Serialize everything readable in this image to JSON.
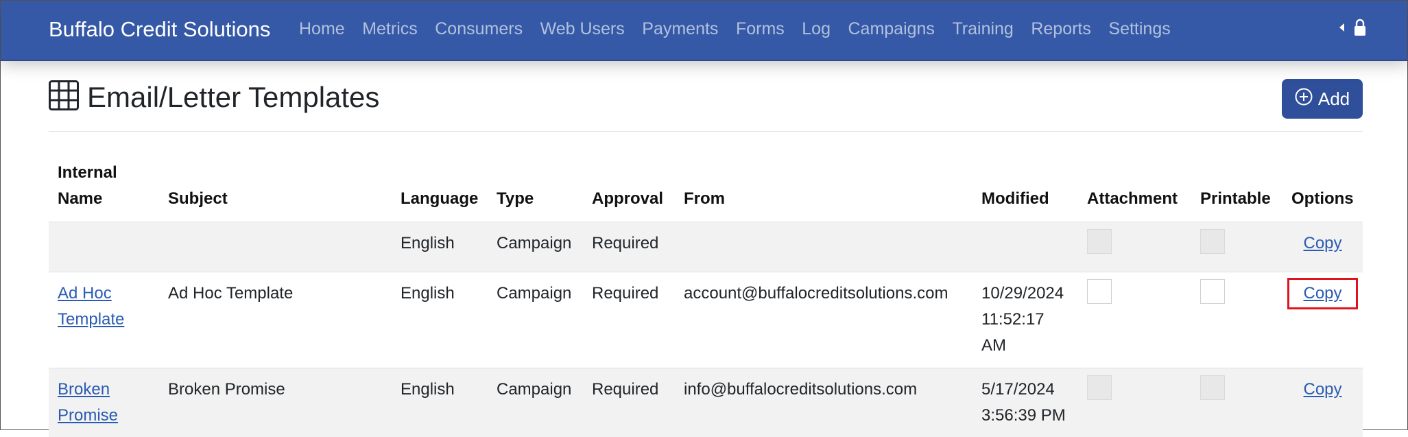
{
  "navbar": {
    "brand": "Buffalo Credit Solutions",
    "links": [
      "Home",
      "Metrics",
      "Consumers",
      "Web Users",
      "Payments",
      "Forms",
      "Log",
      "Campaigns",
      "Training",
      "Reports",
      "Settings"
    ],
    "right_icons": [
      "caret-left-icon",
      "lock-icon"
    ]
  },
  "header": {
    "icon": "grid-icon",
    "title": "Email/Letter Templates",
    "add_label": "Add",
    "add_icon": "plus-circle-icon"
  },
  "table": {
    "columns": {
      "internal_name_1": "Internal",
      "internal_name_2": "Name",
      "subject": "Subject",
      "language": "Language",
      "type": "Type",
      "approval": "Approval",
      "from": "From",
      "modified": "Modified",
      "attachment": "Attachment",
      "printable": "Printable",
      "options": "Options"
    },
    "rows": [
      {
        "name_1": "",
        "name_2": "",
        "subject": "",
        "language": "English",
        "type": "Campaign",
        "approval": "Required",
        "from": "",
        "modified_1": "",
        "modified_2": "",
        "modified_3": "",
        "attachment": false,
        "printable": false,
        "option": "Copy"
      },
      {
        "name_1": "Ad Hoc",
        "name_2": "Template",
        "subject": "Ad Hoc Template",
        "language": "English",
        "type": "Campaign",
        "approval": "Required",
        "from": "account@buffalocreditsolutions.com",
        "modified_1": "10/29/2024",
        "modified_2": "11:52:17",
        "modified_3": "AM",
        "attachment": false,
        "printable": false,
        "option": "Copy"
      },
      {
        "name_1": "Broken",
        "name_2": "Promise",
        "subject": "Broken Promise",
        "language": "English",
        "type": "Campaign",
        "approval": "Required",
        "from": "info@buffalocreditsolutions.com",
        "modified_1": "5/17/2024",
        "modified_2": "3:56:39 PM",
        "modified_3": "",
        "attachment": false,
        "printable": false,
        "option": "Copy"
      }
    ]
  },
  "colors": {
    "navbar": "#3559a7",
    "button": "#2f4f9a",
    "link": "#2a5bb3",
    "highlight": "#e0141e"
  }
}
